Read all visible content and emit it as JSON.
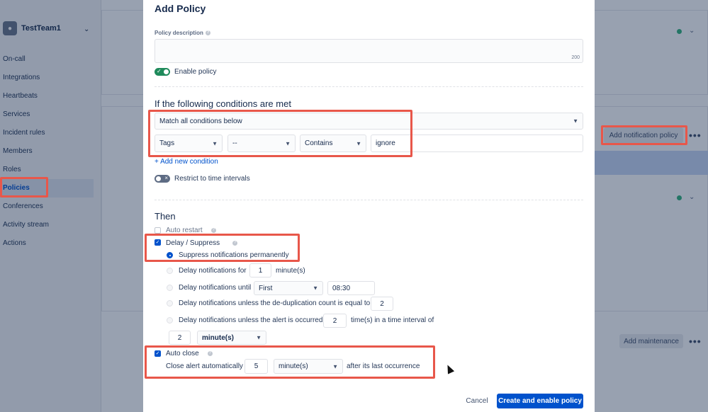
{
  "sidebar": {
    "team_name": "TestTeam1",
    "items": [
      {
        "label": "On-call"
      },
      {
        "label": "Integrations"
      },
      {
        "label": "Heartbeats"
      },
      {
        "label": "Services"
      },
      {
        "label": "Incident rules"
      },
      {
        "label": "Members"
      },
      {
        "label": "Roles"
      },
      {
        "label": "Policies",
        "active": true
      },
      {
        "label": "Conferences"
      },
      {
        "label": "Activity stream"
      },
      {
        "label": "Actions"
      }
    ]
  },
  "background": {
    "add_notification_policy": "Add notification policy",
    "add_maintenance": "Add maintenance",
    "more": "•••"
  },
  "modal": {
    "title": "Add Policy",
    "description_label": "Policy description",
    "description_value": "",
    "description_counter": "200",
    "enable_policy_label": "Enable policy",
    "enable_policy_on": true,
    "conditions_title": "If the following conditions are met",
    "match_select": "Match all conditions below",
    "condition": {
      "field": "Tags",
      "operator_not": "--",
      "operator": "Contains",
      "value": "ignore"
    },
    "add_condition": "+ Add new condition",
    "restrict_label": "Restrict to time intervals",
    "restrict_on": false,
    "then_title": "Then",
    "auto_restart": "Auto restart",
    "delay_suppress": "Delay / Suppress",
    "suppress_permanently": "Suppress notifications permanently",
    "delay_for": {
      "label": "Delay notifications for",
      "value": "1",
      "unit": "minute(s)"
    },
    "delay_until": {
      "label": "Delay notifications until",
      "select": "First",
      "time": "08:30"
    },
    "delay_dedup": {
      "label": "Delay notifications unless the de-duplication count is equal to",
      "value": "2"
    },
    "delay_occurred": {
      "label": "Delay notifications unless the alert is occurred",
      "value": "2",
      "suffix": "time(s) in a time interval of",
      "interval": "2",
      "unit": "minute(s)"
    },
    "auto_close": "Auto close",
    "close_label": "Close alert automatically",
    "close_value": "5",
    "close_unit": "minute(s)",
    "close_suffix": "after its last occurrence",
    "cancel": "Cancel",
    "create": "Create and enable policy"
  },
  "colors": {
    "accent": "#0052cc",
    "highlight": "#e8574a",
    "toggle_on": "#1f8a5b"
  }
}
